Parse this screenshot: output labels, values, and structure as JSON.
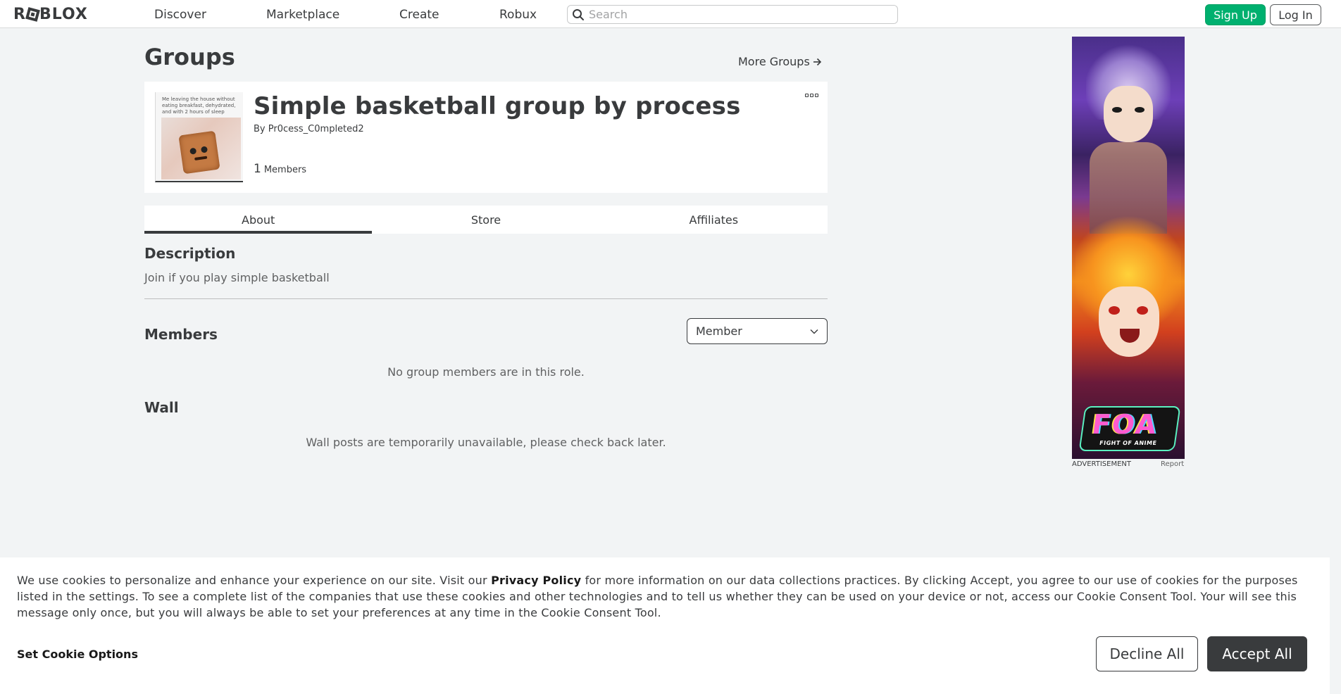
{
  "header": {
    "logo_text": "ROBLOX",
    "nav": [
      "Discover",
      "Marketplace",
      "Create",
      "Robux"
    ],
    "search_placeholder": "Search",
    "signup_label": "Sign Up",
    "login_label": "Log In"
  },
  "page": {
    "title": "Groups",
    "more_groups_label": "More Groups"
  },
  "group": {
    "name": "Simple basketball group by process",
    "by_label": "By",
    "owner": "Pr0cess_C0mpleted2",
    "member_count": "1",
    "members_label": "Members",
    "thumbnail_caption": "Me leaving the house without eating breakfast, dehydrated, and with 2 hours of sleep"
  },
  "tabs": [
    "About",
    "Store",
    "Affiliates"
  ],
  "active_tab": "About",
  "about": {
    "description_title": "Description",
    "description_text": "Join if you play simple basketball",
    "members_title": "Members",
    "role_selected": "Member",
    "no_members_msg": "No group members are in this role.",
    "wall_title": "Wall",
    "wall_msg": "Wall posts are temporarily unavailable, please check back later."
  },
  "ad": {
    "logo_text": "FOA",
    "logo_subtitle": "FIGHT OF ANIME",
    "label": "ADVERTISEMENT",
    "report_label": "Report"
  },
  "cookie_banner": {
    "text_before": "We use cookies to personalize and enhance your experience on our site. Visit our ",
    "privacy_link": "Privacy Policy",
    "text_after": " for more information on our data collections practices. By clicking Accept, you agree to our use of cookies for the purposes listed in the settings. To see a complete list of the companies that use these cookies and other technologies and to tell us whether they can be used on your device or not, access our Cookie Consent Tool. Your will see this message only once, but you will always be able to set your preferences at any time in the Cookie Consent Tool.",
    "options_label": "Set Cookie Options",
    "decline_label": "Decline All",
    "accept_label": "Accept All"
  },
  "colors": {
    "signup_green": "#00b06f",
    "text_dark": "#393b3d",
    "page_bg": "#f2f4f5"
  }
}
